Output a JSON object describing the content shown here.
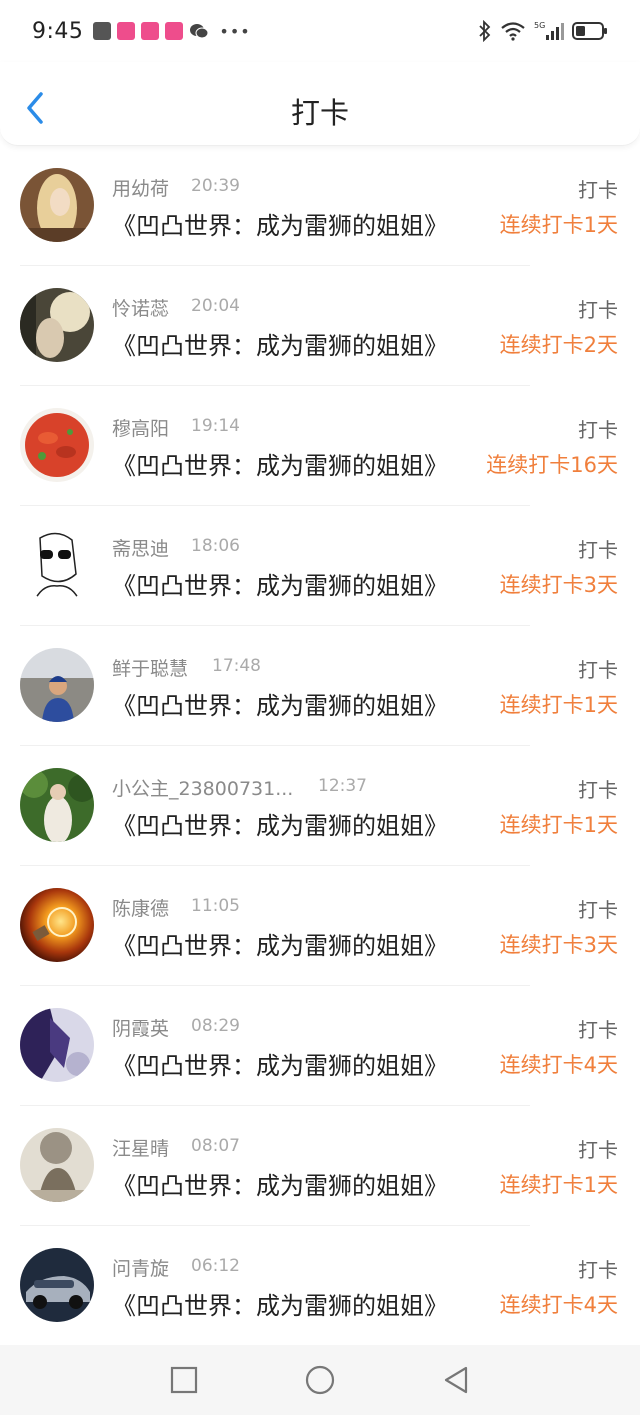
{
  "status_bar": {
    "time": "9:45",
    "network": "5G"
  },
  "header": {
    "title": "打卡"
  },
  "entries": [
    {
      "name": "用幼荷",
      "time": "20:39",
      "book": "《凹凸世界：成为雷狮的姐姐》",
      "label": "打卡",
      "streak": "连续打卡1天"
    },
    {
      "name": "怜诺蕊",
      "time": "20:04",
      "book": "《凹凸世界：成为雷狮的姐姐》",
      "label": "打卡",
      "streak": "连续打卡2天"
    },
    {
      "name": "穆高阳",
      "time": "19:14",
      "book": "《凹凸世界：成为雷狮的姐姐》",
      "label": "打卡",
      "streak": "连续打卡16天"
    },
    {
      "name": "斋思迪",
      "time": "18:06",
      "book": "《凹凸世界：成为雷狮的姐姐》",
      "label": "打卡",
      "streak": "连续打卡3天"
    },
    {
      "name": "鲜于聪慧",
      "time": "17:48",
      "book": "《凹凸世界：成为雷狮的姐姐》",
      "label": "打卡",
      "streak": "连续打卡1天"
    },
    {
      "name": "小公主_23800731...",
      "time": "12:37",
      "book": "《凹凸世界：成为雷狮的姐姐》",
      "label": "打卡",
      "streak": "连续打卡1天"
    },
    {
      "name": "陈康德",
      "time": "11:05",
      "book": "《凹凸世界：成为雷狮的姐姐》",
      "label": "打卡",
      "streak": "连续打卡3天"
    },
    {
      "name": "阴霞英",
      "time": "08:29",
      "book": "《凹凸世界：成为雷狮的姐姐》",
      "label": "打卡",
      "streak": "连续打卡4天"
    },
    {
      "name": "汪星晴",
      "time": "08:07",
      "book": "《凹凸世界：成为雷狮的姐姐》",
      "label": "打卡",
      "streak": "连续打卡1天"
    },
    {
      "name": "问青旋",
      "time": "06:12",
      "book": "《凹凸世界：成为雷狮的姐姐》",
      "label": "打卡",
      "streak": "连续打卡4天"
    }
  ],
  "colors": {
    "accent": "#2b8ce8",
    "streak": "#f07f3c"
  },
  "icons": {
    "back": "chevron-left-icon",
    "nav": [
      "square-icon",
      "circle-icon",
      "triangle-left-icon"
    ]
  }
}
